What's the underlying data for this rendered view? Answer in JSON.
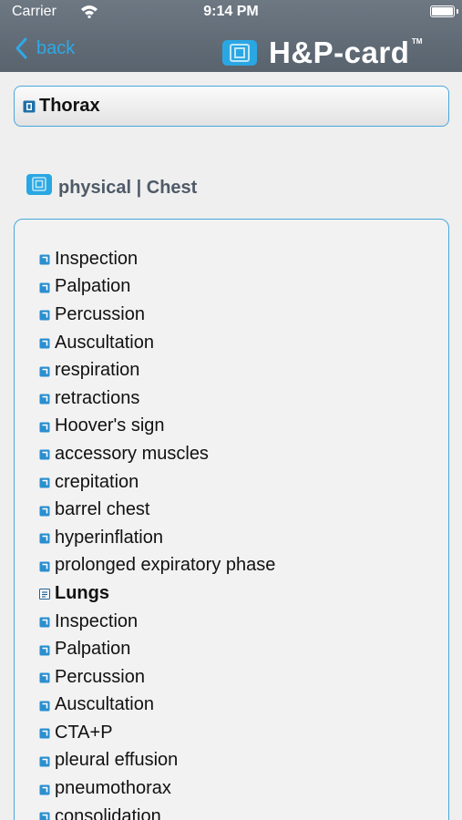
{
  "status_bar": {
    "carrier": "Carrier",
    "time": "9:14 PM"
  },
  "nav": {
    "back_label": "back",
    "app_title": "H&P-card",
    "trademark": "TM"
  },
  "section": {
    "title": "Thorax"
  },
  "subheading": {
    "text": "physical | Chest"
  },
  "list": {
    "items": [
      {
        "label": "Inspection",
        "kind": "link"
      },
      {
        "label": "Palpation",
        "kind": "link"
      },
      {
        "label": "Percussion",
        "kind": "link"
      },
      {
        "label": "Auscultation",
        "kind": "link"
      },
      {
        "label": "respiration",
        "kind": "link"
      },
      {
        "label": "retractions",
        "kind": "link"
      },
      {
        "label": "Hoover's sign",
        "kind": "link"
      },
      {
        "label": "accessory muscles",
        "kind": "link"
      },
      {
        "label": "crepitation",
        "kind": "link"
      },
      {
        "label": "barrel chest",
        "kind": "link"
      },
      {
        "label": "hyperinflation",
        "kind": "link"
      },
      {
        "label": "prolonged expiratory phase",
        "kind": "link"
      },
      {
        "label": "Lungs",
        "kind": "heading"
      },
      {
        "label": "Inspection",
        "kind": "link"
      },
      {
        "label": "Palpation",
        "kind": "link"
      },
      {
        "label": "Percussion",
        "kind": "link"
      },
      {
        "label": "Auscultation",
        "kind": "link"
      },
      {
        "label": "CTA+P",
        "kind": "link"
      },
      {
        "label": "pleural effusion",
        "kind": "link"
      },
      {
        "label": "pneumothorax",
        "kind": "link"
      },
      {
        "label": "consolidation",
        "kind": "link"
      }
    ]
  },
  "colors": {
    "accent": "#2fa9e6",
    "header": "#616b76",
    "border": "#49a7dc"
  }
}
